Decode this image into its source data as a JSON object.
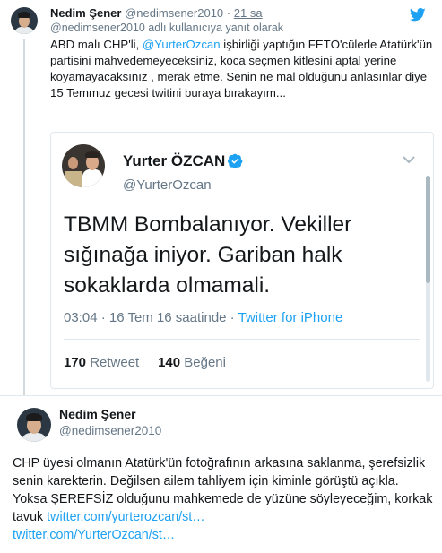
{
  "tweet1": {
    "name": "Nedim Şener",
    "handle": "@nedimsener2010",
    "separator": "·",
    "time": "21 sa",
    "reply_to": "@nedimsener2010 adlı kullanıcıya yanıt olarak",
    "body": {
      "part1": "ABD malı CHP'li, ",
      "mention": "@YurterOzcan",
      "part2": " işbirliği yaptığın FETÖ'cülerle Atatürk'ün partisini mahvedemeyeceksiniz, koca seçmen kitlesini aptal yerine koyamayacaksınız , merak etme. Senin ne mal olduğunu anlasınlar diye 15 Temmuz gecesi twitini buraya bırakayım..."
    }
  },
  "embedded": {
    "name": "Yurter ÖZCAN",
    "handle": "@YurterOzcan",
    "text": "TBMM Bombalanıyor. Vekiller sığınağa iniyor. Gariban halk sokaklarda olmamali.",
    "time": "03:04 · 16 Tem 16 saatinde · ",
    "source": "Twitter for iPhone",
    "retweet_count": "170",
    "retweet_label": " Retweet",
    "like_count": "140",
    "like_label": " Beğeni"
  },
  "tweet2": {
    "name": "Nedim Şener",
    "handle": "@nedimsener2010",
    "body": "CHP üyesi olmanın Atatürk'ün fotoğrafının arkasına saklanma, şerefsizlik senin karekterin. Değilsen ailem tahliyem için kiminle görüştü açıkla. Yoksa ŞEREFSİZ olduğunu mahkemede de yüzüne söyleyeceğim, korkak tavuk ",
    "link1": "twitter.com/yurterozcan/st…",
    "link2": "twitter.com/YurterOzcan/st…"
  },
  "colors": {
    "accent": "#1da1f2",
    "muted": "#657786",
    "text": "#14171a",
    "border": "#e1e8ed"
  },
  "icons": {
    "bird": "twitter-bird-icon",
    "verified": "verified-badge-icon",
    "chevron": "chevron-down-icon"
  }
}
